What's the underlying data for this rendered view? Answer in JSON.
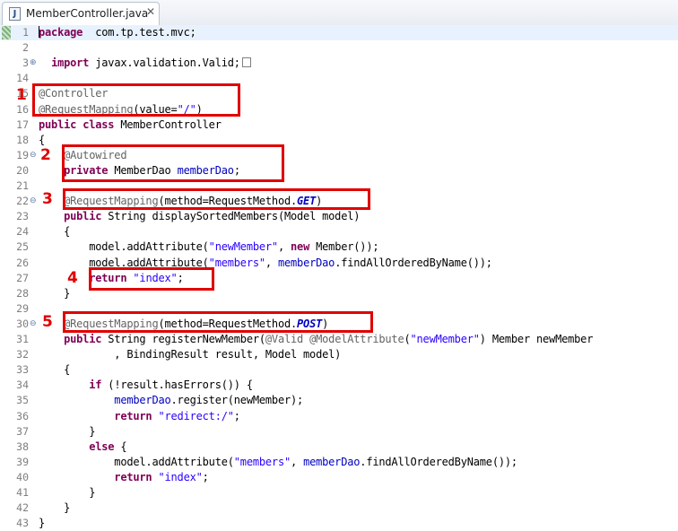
{
  "tab": {
    "label": "MemberController.java",
    "close": "✕",
    "icon_letter": "J"
  },
  "lines": [
    {
      "n": "1",
      "fold": "",
      "parts": [
        [
          "caret",
          ""
        ],
        [
          "kw",
          "package"
        ],
        [
          "",
          "  com.tp.test.mvc;"
        ]
      ]
    },
    {
      "n": "2",
      "fold": "",
      "parts": []
    },
    {
      "n": "3",
      "fold": "⊕",
      "parts": [
        [
          "",
          "  "
        ],
        [
          "kw",
          "import"
        ],
        [
          "",
          " javax.validation.Valid;"
        ],
        [
          "foldbox",
          ""
        ]
      ]
    },
    {
      "n": "14",
      "fold": "",
      "parts": []
    },
    {
      "n": "15",
      "fold": "",
      "parts": [
        [
          "an",
          "@Controller"
        ]
      ]
    },
    {
      "n": "16",
      "fold": "",
      "parts": [
        [
          "an",
          "@RequestMapping"
        ],
        [
          "",
          "(value="
        ],
        [
          "str",
          "\"/\""
        ],
        [
          "",
          ")"
        ]
      ]
    },
    {
      "n": "17",
      "fold": "",
      "parts": [
        [
          "kw",
          "public"
        ],
        [
          "",
          " "
        ],
        [
          "kw",
          "class"
        ],
        [
          "",
          " MemberController"
        ]
      ]
    },
    {
      "n": "18",
      "fold": "",
      "parts": [
        [
          "",
          "{"
        ]
      ]
    },
    {
      "n": "19",
      "fold": "⊖",
      "parts": [
        [
          "",
          "    "
        ],
        [
          "an",
          "@Autowired"
        ]
      ]
    },
    {
      "n": "20",
      "fold": "",
      "parts": [
        [
          "",
          "    "
        ],
        [
          "kw",
          "private"
        ],
        [
          "",
          " MemberDao "
        ],
        [
          "fld",
          "memberDao"
        ],
        [
          "",
          ";"
        ]
      ]
    },
    {
      "n": "21",
      "fold": "",
      "parts": []
    },
    {
      "n": "22",
      "fold": "⊖",
      "parts": [
        [
          "",
          "    "
        ],
        [
          "an",
          "@RequestMapping"
        ],
        [
          "",
          "(method=RequestMethod."
        ],
        [
          "itk",
          "GET"
        ],
        [
          "",
          ")"
        ]
      ]
    },
    {
      "n": "23",
      "fold": "",
      "parts": [
        [
          "",
          "    "
        ],
        [
          "kw",
          "public"
        ],
        [
          "",
          " String displaySortedMembers(Model model)"
        ]
      ]
    },
    {
      "n": "24",
      "fold": "",
      "parts": [
        [
          "",
          "    {"
        ]
      ]
    },
    {
      "n": "25",
      "fold": "",
      "parts": [
        [
          "",
          "        model.addAttribute("
        ],
        [
          "str",
          "\"newMember\""
        ],
        [
          "",
          ", "
        ],
        [
          "kw",
          "new"
        ],
        [
          "",
          " Member());"
        ]
      ]
    },
    {
      "n": "26",
      "fold": "",
      "parts": [
        [
          "",
          "        model.addAttribute("
        ],
        [
          "str",
          "\"members\""
        ],
        [
          "",
          ", "
        ],
        [
          "fld",
          "memberDao"
        ],
        [
          "",
          ".findAllOrderedByName());"
        ]
      ]
    },
    {
      "n": "27",
      "fold": "",
      "parts": [
        [
          "",
          "        "
        ],
        [
          "kw",
          "return"
        ],
        [
          "",
          " "
        ],
        [
          "str",
          "\"index\""
        ],
        [
          "",
          ";"
        ]
      ]
    },
    {
      "n": "28",
      "fold": "",
      "parts": [
        [
          "",
          "    }"
        ]
      ]
    },
    {
      "n": "29",
      "fold": "",
      "parts": []
    },
    {
      "n": "30",
      "fold": "⊖",
      "parts": [
        [
          "",
          "    "
        ],
        [
          "an",
          "@RequestMapping"
        ],
        [
          "",
          "(method=RequestMethod."
        ],
        [
          "itk",
          "POST"
        ],
        [
          "",
          ")"
        ]
      ]
    },
    {
      "n": "31",
      "fold": "",
      "parts": [
        [
          "",
          "    "
        ],
        [
          "kw",
          "public"
        ],
        [
          "",
          " String registerNewMember("
        ],
        [
          "an",
          "@Valid"
        ],
        [
          "",
          " "
        ],
        [
          "an",
          "@ModelAttribute"
        ],
        [
          "",
          "("
        ],
        [
          "str",
          "\"newMember\""
        ],
        [
          "",
          ") Member newMember"
        ]
      ]
    },
    {
      "n": "32",
      "fold": "",
      "parts": [
        [
          "",
          "            , BindingResult result, Model model)"
        ]
      ]
    },
    {
      "n": "33",
      "fold": "",
      "parts": [
        [
          "",
          "    {"
        ]
      ]
    },
    {
      "n": "34",
      "fold": "",
      "parts": [
        [
          "",
          "        "
        ],
        [
          "kw",
          "if"
        ],
        [
          "",
          " (!result.hasErrors()) {"
        ]
      ]
    },
    {
      "n": "35",
      "fold": "",
      "parts": [
        [
          "",
          "            "
        ],
        [
          "fld",
          "memberDao"
        ],
        [
          "",
          ".register(newMember);"
        ]
      ]
    },
    {
      "n": "36",
      "fold": "",
      "parts": [
        [
          "",
          "            "
        ],
        [
          "kw",
          "return"
        ],
        [
          "",
          " "
        ],
        [
          "str",
          "\"redirect:/\""
        ],
        [
          "",
          ";"
        ]
      ]
    },
    {
      "n": "37",
      "fold": "",
      "parts": [
        [
          "",
          "        }"
        ]
      ]
    },
    {
      "n": "38",
      "fold": "",
      "parts": [
        [
          "",
          "        "
        ],
        [
          "kw",
          "else"
        ],
        [
          "",
          " {"
        ]
      ]
    },
    {
      "n": "39",
      "fold": "",
      "parts": [
        [
          "",
          "            model.addAttribute("
        ],
        [
          "str",
          "\"members\""
        ],
        [
          "",
          ", "
        ],
        [
          "fld",
          "memberDao"
        ],
        [
          "",
          ".findAllOrderedByName());"
        ]
      ]
    },
    {
      "n": "40",
      "fold": "",
      "parts": [
        [
          "",
          "            "
        ],
        [
          "kw",
          "return"
        ],
        [
          "",
          " "
        ],
        [
          "str",
          "\"index\""
        ],
        [
          "",
          ";"
        ]
      ]
    },
    {
      "n": "41",
      "fold": "",
      "parts": [
        [
          "",
          "        }"
        ]
      ]
    },
    {
      "n": "42",
      "fold": "",
      "parts": [
        [
          "",
          "    }"
        ]
      ]
    },
    {
      "n": "43",
      "fold": "",
      "parts": [
        [
          "",
          "}"
        ]
      ]
    }
  ],
  "annotations": [
    "1",
    "2",
    "3",
    "4",
    "5"
  ],
  "colors": {
    "annotation": "#e00000",
    "keyword": "#7f0055",
    "annotation_text": "#646464",
    "string": "#2a00ff",
    "field": "#0000c0",
    "current_line": "#e8f2fe"
  }
}
